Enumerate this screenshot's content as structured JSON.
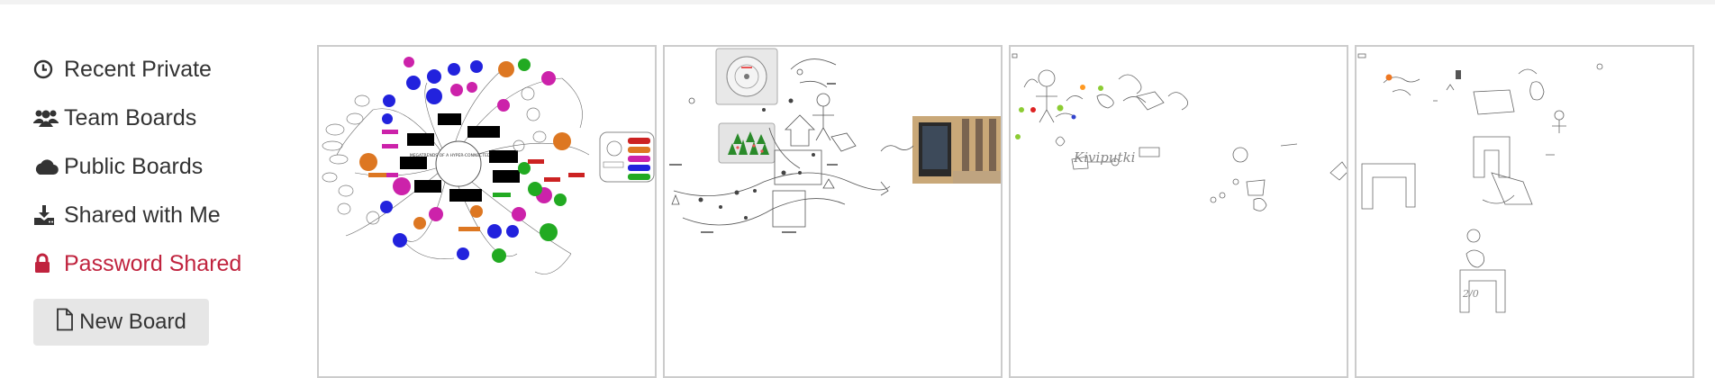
{
  "sidebar": {
    "items": [
      {
        "label": "Recent Private",
        "icon": "clock-icon",
        "active": false
      },
      {
        "label": "Team Boards",
        "icon": "users-icon",
        "active": false
      },
      {
        "label": "Public Boards",
        "icon": "cloud-icon",
        "active": false
      },
      {
        "label": "Shared with Me",
        "icon": "download-icon",
        "active": false
      },
      {
        "label": "Password Shared",
        "icon": "lock-icon",
        "active": true
      }
    ],
    "new_board_label": "New Board"
  },
  "colors": {
    "text": "#333333",
    "active": "#c0233e",
    "button_bg": "#e6e6e6",
    "card_border": "#cccccc"
  },
  "boards": [
    {
      "thumbnail": "mind-map-thumbnail",
      "labels": [
        "MEGATRENDS OF A HYPER-CONNECTED PLANET"
      ]
    },
    {
      "thumbnail": "flow-sketch-thumbnail"
    },
    {
      "thumbnail": "handwriting-sketch-thumbnail",
      "labels": [
        "Kiviputki"
      ]
    },
    {
      "thumbnail": "shapes-sketch-thumbnail",
      "labels": [
        "2/0"
      ]
    }
  ]
}
